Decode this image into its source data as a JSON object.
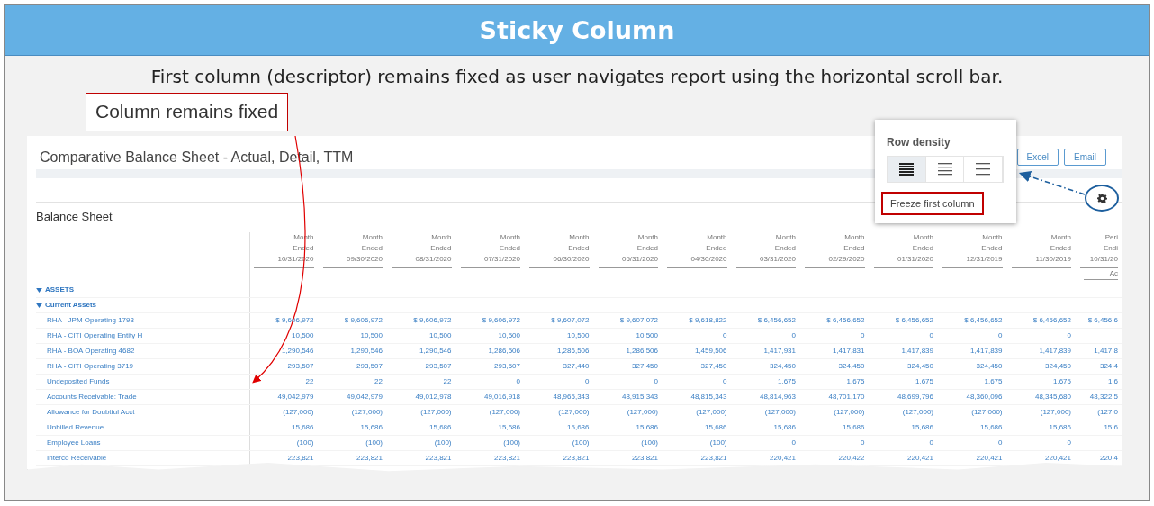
{
  "slide_title": "Sticky Column",
  "subtitle": "First column (descriptor) remains fixed as user navigates report using the horizontal scroll bar.",
  "callout": "Column remains fixed",
  "report": {
    "title": "Comparative Balance Sheet - Actual, Detail, TTM",
    "buttons": [
      "Excel",
      "Email"
    ],
    "section": "Balance Sheet",
    "columns": [
      {
        "line1": "Month",
        "line2": "Ended",
        "date": "10/31/2020"
      },
      {
        "line1": "Month",
        "line2": "Ended",
        "date": "09/30/2020"
      },
      {
        "line1": "Month",
        "line2": "Ended",
        "date": "08/31/2020"
      },
      {
        "line1": "Month",
        "line2": "Ended",
        "date": "07/31/2020"
      },
      {
        "line1": "Month",
        "line2": "Ended",
        "date": "06/30/2020"
      },
      {
        "line1": "Month",
        "line2": "Ended",
        "date": "05/31/2020"
      },
      {
        "line1": "Month",
        "line2": "Ended",
        "date": "04/30/2020"
      },
      {
        "line1": "Month",
        "line2": "Ended",
        "date": "03/31/2020"
      },
      {
        "line1": "Month",
        "line2": "Ended",
        "date": "02/29/2020"
      },
      {
        "line1": "Month",
        "line2": "Ended",
        "date": "01/31/2020"
      },
      {
        "line1": "Month",
        "line2": "Ended",
        "date": "12/31/2019"
      },
      {
        "line1": "Month",
        "line2": "Ended",
        "date": "11/30/2019"
      },
      {
        "line1": "Peri",
        "line2": "Endi",
        "date": "10/31/20",
        "subheading": "Ac"
      }
    ],
    "rows": [
      {
        "kind": "group",
        "label": "ASSETS",
        "expanded": true
      },
      {
        "kind": "group",
        "label": "Current Assets",
        "expanded": true
      },
      {
        "kind": "item",
        "label": "RHA - JPM Operating 1793",
        "values": [
          "$ 9,606,972",
          "$ 9,606,972",
          "$ 9,606,972",
          "$ 9,606,972",
          "$ 9,607,072",
          "$ 9,607,072",
          "$ 9,618,822",
          "$ 6,456,652",
          "$ 6,456,652",
          "$ 6,456,652",
          "$ 6,456,652",
          "$ 6,456,652",
          "$ 6,456,6"
        ]
      },
      {
        "kind": "item",
        "label": "RHA - CITI Operating Entity H",
        "values": [
          "10,500",
          "10,500",
          "10,500",
          "10,500",
          "10,500",
          "10,500",
          "0",
          "0",
          "0",
          "0",
          "0",
          "0"
        ]
      },
      {
        "kind": "item",
        "label": "RHA - BOA Operating 4682",
        "values": [
          "1,290,546",
          "1,290,546",
          "1,290,546",
          "1,286,506",
          "1,286,506",
          "1,286,506",
          "1,459,506",
          "1,417,931",
          "1,417,831",
          "1,417,839",
          "1,417,839",
          "1,417,839",
          "1,417,8"
        ]
      },
      {
        "kind": "item",
        "label": "RHA - CITI Operating 3719",
        "values": [
          "293,507",
          "293,507",
          "293,507",
          "293,507",
          "327,440",
          "327,450",
          "327,450",
          "324,450",
          "324,450",
          "324,450",
          "324,450",
          "324,450",
          "324,4"
        ]
      },
      {
        "kind": "item",
        "label": "Undeposited Funds",
        "values": [
          "22",
          "22",
          "22",
          "0",
          "0",
          "0",
          "0",
          "1,675",
          "1,675",
          "1,675",
          "1,675",
          "1,675",
          "1,6"
        ]
      },
      {
        "kind": "item",
        "label": "Accounts Receivable: Trade",
        "values": [
          "49,042,979",
          "49,042,979",
          "49,012,978",
          "49,016,918",
          "48,965,343",
          "48,915,343",
          "48,815,343",
          "48,814,963",
          "48,701,170",
          "48,699,796",
          "48,360,096",
          "48,345,680",
          "48,322,5"
        ]
      },
      {
        "kind": "item",
        "label": "Allowance for Doubtful Acct",
        "values": [
          "(127,000)",
          "(127,000)",
          "(127,000)",
          "(127,000)",
          "(127,000)",
          "(127,000)",
          "(127,000)",
          "(127,000)",
          "(127,000)",
          "(127,000)",
          "(127,000)",
          "(127,000)",
          "(127,0"
        ]
      },
      {
        "kind": "item",
        "label": "Unbilled Revenue",
        "values": [
          "15,686",
          "15,686",
          "15,686",
          "15,686",
          "15,686",
          "15,686",
          "15,686",
          "15,686",
          "15,686",
          "15,686",
          "15,686",
          "15,686",
          "15,6"
        ]
      },
      {
        "kind": "item",
        "label": "Employee Loans",
        "values": [
          "(100)",
          "(100)",
          "(100)",
          "(100)",
          "(100)",
          "(100)",
          "(100)",
          "0",
          "0",
          "0",
          "0",
          "0"
        ]
      },
      {
        "kind": "item",
        "label": "Interco Receivable",
        "values": [
          "223,821",
          "223,821",
          "223,821",
          "223,821",
          "223,821",
          "223,821",
          "223,821",
          "220,421",
          "220,422",
          "220,421",
          "220,421",
          "220,421",
          "220,4"
        ]
      }
    ]
  },
  "popup": {
    "title": "Row density",
    "density_options": [
      {
        "kind": "compact",
        "selected": true
      },
      {
        "kind": "normal",
        "selected": false
      },
      {
        "kind": "spacious",
        "selected": false
      }
    ],
    "freeze_label": "Freeze first column"
  }
}
